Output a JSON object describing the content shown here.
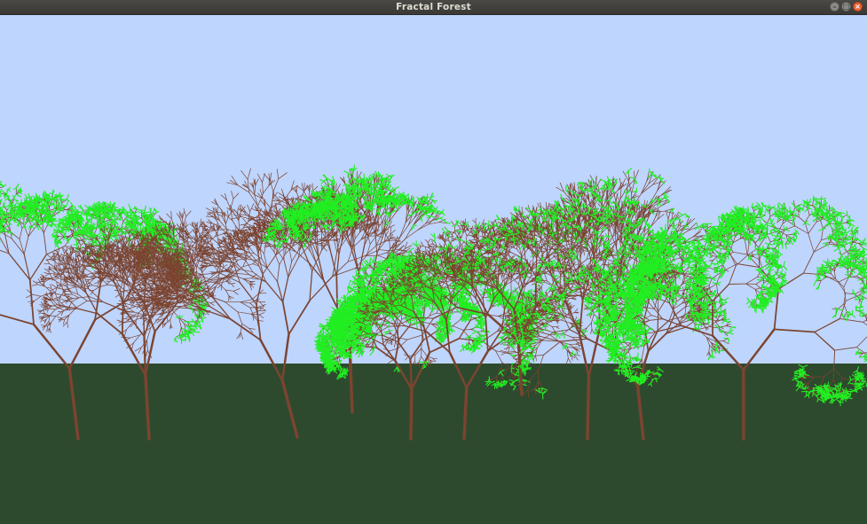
{
  "window": {
    "title": "Fractal Forest",
    "controls": [
      "minimize-icon",
      "maximize-icon",
      "close-icon"
    ]
  },
  "scene": {
    "colors": {
      "sky": "#bed5fe",
      "ground": "#2e4a2e",
      "trunk": "#7b4430",
      "leaf": "#22ee22"
    },
    "tree_count": 10
  }
}
